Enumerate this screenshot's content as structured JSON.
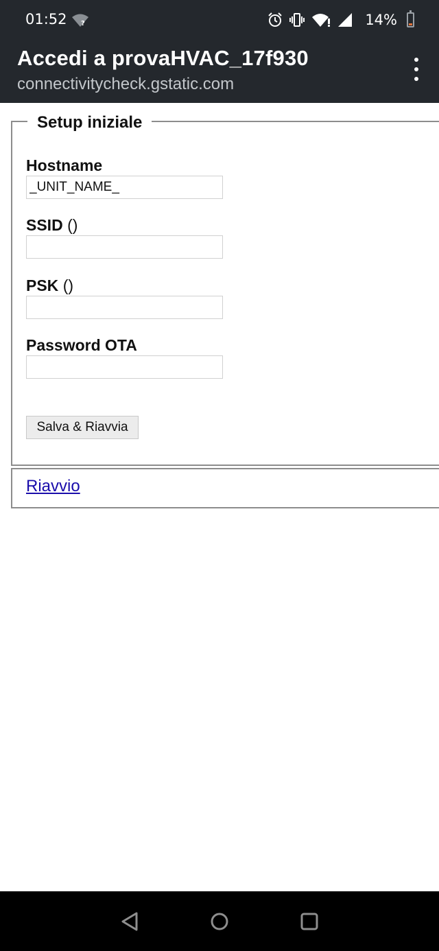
{
  "status_bar": {
    "time": "01:52",
    "battery_percent": "14%",
    "battery_level": 0.14,
    "battery_color": "#e0733c",
    "icons": [
      "wifi-question-icon",
      "alarm-icon",
      "vibrate-icon",
      "wifi-icon",
      "signal-icon",
      "battery-icon"
    ]
  },
  "app_bar": {
    "title": "Accedi a provaHVAC_17f930",
    "url": "connectivitycheck.gstatic.com",
    "menu_icon": "more-vert-icon"
  },
  "form": {
    "legend": "Setup iniziale",
    "fields": [
      {
        "label": "Hostname",
        "suffix": "",
        "value": "_UNIT_NAME_"
      },
      {
        "label": "SSID",
        "suffix": "()",
        "value": ""
      },
      {
        "label": "PSK",
        "suffix": "()",
        "value": ""
      },
      {
        "label": "Password OTA",
        "suffix": "",
        "value": ""
      }
    ],
    "submit_label": "Salva & Riavvia"
  },
  "reboot_link": "Riavvio",
  "nav_bar": {
    "icons": [
      "back-icon",
      "home-icon",
      "recents-icon"
    ]
  }
}
